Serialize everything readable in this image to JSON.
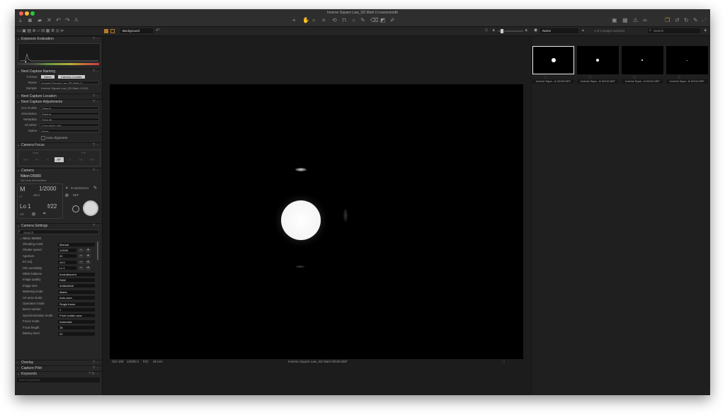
{
  "window": {
    "title": "Inverse Square Law_SD Mark II.cosessiondb",
    "traffic_colors": [
      "#fe5f57",
      "#febc2e",
      "#28c840"
    ]
  },
  "toolbar": {
    "left_icons": [
      "import-icon",
      "camera-icon",
      "folder-icon",
      "delete-icon",
      "undo-icon",
      "redo-icon",
      "text-icon"
    ],
    "center_icons": [
      "cursor-tool-icon",
      "pan-tool-icon",
      "loupe-tool-icon",
      "crop-tool-icon",
      "rotate-tool-icon",
      "keystone-tool-icon",
      "spot-tool-icon",
      "brush-tool-icon",
      "eraser-tool-icon",
      "gradient-tool-icon",
      "picker-tool-icon"
    ],
    "right_icons": [
      "compare-icon",
      "grid-icon",
      "warning-icon",
      "proof-icon",
      "process-icon",
      "rotate-left-icon",
      "rotate-right-icon",
      "edit-icon",
      "reset-icon"
    ]
  },
  "subbar": {
    "background_label": "Background",
    "sort_label": "Name",
    "selection_text": "1 of 4 images selected",
    "search_placeholder": "Search"
  },
  "left_panel": {
    "exposure_evaluation": "Exposure Evaluation",
    "next_capture_naming": "Next Capture Naming",
    "format_label": "Format",
    "format_tokens": [
      "Name",
      "Camera Counter"
    ],
    "name_label": "Name",
    "name_value": "Inverse Square Law_SD Mark II",
    "sample_label": "Sample",
    "sample_value": "Inverse Square Law_SD Mark II 0110",
    "next_capture_location": "Next Capture Location",
    "next_capture_adjustments": "Next Capture Adjustments",
    "adjustments": [
      {
        "label": "ICC Profile",
        "value": "Default"
      },
      {
        "label": "Orientation",
        "value": "Default"
      },
      {
        "label": "Metadata",
        "value": "Defaults"
      },
      {
        "label": "All Other",
        "value": "Copy from Last"
      },
      {
        "label": "Styles",
        "value": "None"
      }
    ],
    "auto_alignment": "Auto Alignment",
    "camera_focus": "Camera Focus",
    "focus_near": "Near",
    "focus_far": "Far",
    "focus_steps": [
      "<<<",
      "<<",
      "<",
      "AF",
      ">",
      ">>",
      ">>>"
    ],
    "camera_section": "Camera",
    "camera_model": "Nikon D5000",
    "lens_info": "No Lens Information",
    "cam_mode": "M",
    "cam_shutter": "1/2000",
    "cam_ev": "±0.0",
    "cam_iso": "Lo 1",
    "cam_aperture": "f/22",
    "wb_label": "Incandescent",
    "nef_label": "NEF",
    "camera_settings": "Camera Settings",
    "search_placeholder": "Search",
    "settings_group": "Nikon D5000",
    "settings": [
      {
        "label": "Shooting mode",
        "value": "Manual",
        "stepper": false
      },
      {
        "label": "Shutter speed",
        "value": "1/2000",
        "stepper": true
      },
      {
        "label": "Aperture",
        "value": "22",
        "stepper": true
      },
      {
        "label": "EV adj.",
        "value": "±0.0",
        "stepper": true
      },
      {
        "label": "ISO sensitivity",
        "value": "Lo 1",
        "stepper": true
      },
      {
        "label": "White balance",
        "value": "Incandescent",
        "stepper": false
      },
      {
        "label": "Image quality",
        "value": "RAW",
        "stepper": false
      },
      {
        "label": "Image size",
        "value": "4288x2848",
        "stepper": false
      },
      {
        "label": "Metering mode",
        "value": "Matrix",
        "stepper": false
      },
      {
        "label": "AF-area mode",
        "value": "Auto-area",
        "stepper": false
      },
      {
        "label": "Operation mode",
        "value": "Single frame",
        "stepper": false
      },
      {
        "label": "Burst number",
        "value": "1",
        "stepper": false
      },
      {
        "label": "Synchronization mode",
        "value": "Front curtain sync",
        "stepper": false
      },
      {
        "label": "Focus mode",
        "value": "Automatic",
        "stepper": false
      },
      {
        "label": "Focal length",
        "value": "18",
        "stepper": false
      },
      {
        "label": "Battery level",
        "value": "20",
        "stepper": false
      }
    ],
    "overlay": "Overlay",
    "capture_pilot": "Capture Pilot",
    "keywords": "Keywords",
    "keywords_placeholder": "Enter keywords"
  },
  "viewer": {
    "status_iso": "ISO 100",
    "status_shutter": "1/2000 s",
    "status_aperture": "f/22",
    "status_focal": "26 mm",
    "status_filename": "Inverse Square Law_SD Mark II0109.NEF"
  },
  "browser": {
    "thumbnails": [
      {
        "filename": "Inverse Squa...rk II0109.NEF",
        "selected": true
      },
      {
        "filename": "Inverse Squa...rk II0110.NEF",
        "selected": false
      },
      {
        "filename": "Inverse Squa...rk II0111.NEF",
        "selected": false
      },
      {
        "filename": "Inverse Squa...rk II0112.NEF",
        "selected": false
      }
    ]
  }
}
